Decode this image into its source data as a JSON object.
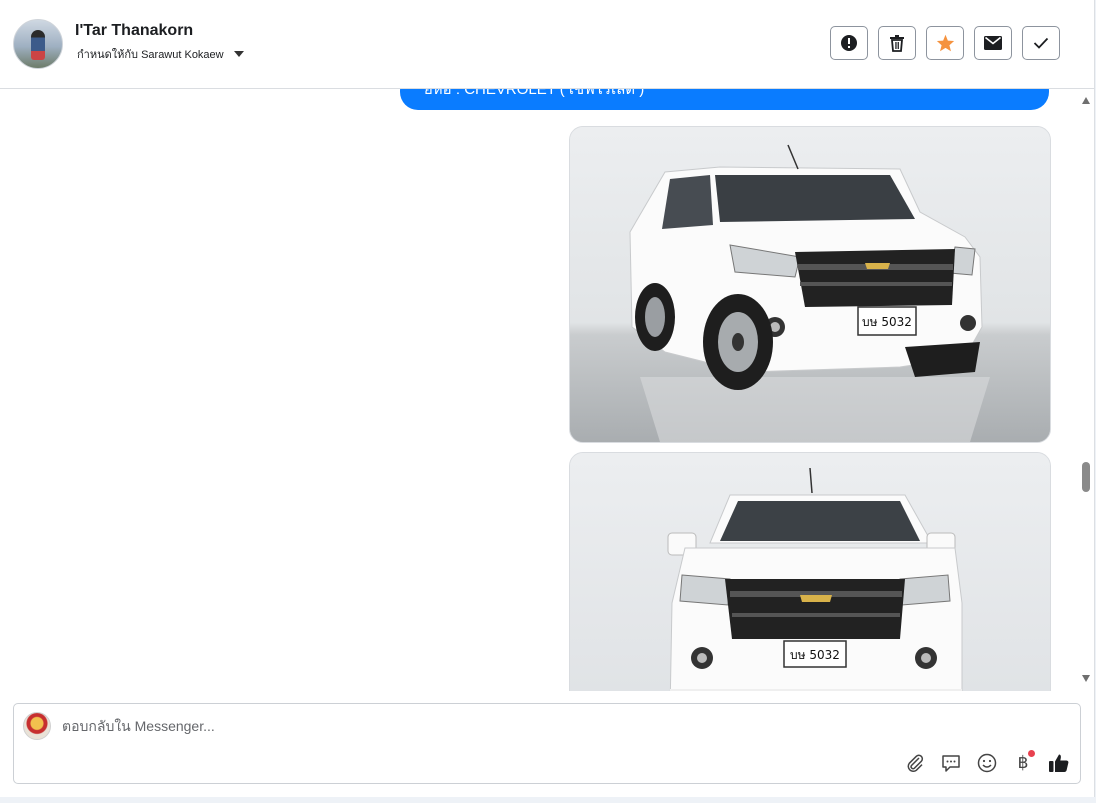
{
  "header": {
    "contact_name": "I'Tar Thanakorn",
    "assigned_label": "กำหนดให้กับ Sarawut Kokaew",
    "actions": [
      {
        "name": "mark-spam",
        "icon": "alert-circle-icon"
      },
      {
        "name": "delete",
        "icon": "trash-icon"
      },
      {
        "name": "star",
        "icon": "star-icon",
        "active_color": "#f5923e"
      },
      {
        "name": "mark-unread",
        "icon": "envelope-icon"
      },
      {
        "name": "mark-done",
        "icon": "check-icon"
      }
    ]
  },
  "conversation": {
    "message_text": "ยี่ห้อ : CHEVROLET ( เชฟโรเลต )",
    "bubble_color": "#0a7cff",
    "photos": [
      {
        "plate": "บษ 5032"
      },
      {
        "plate": "บษ 5032"
      }
    ]
  },
  "composer": {
    "placeholder": "ตอบกลับใน Messenger...",
    "tools": [
      "paperclip-icon",
      "saved-replies-icon",
      "emoji-icon",
      "payment-baht-icon",
      "thumbs-up-icon"
    ],
    "baht_symbol": "฿"
  }
}
